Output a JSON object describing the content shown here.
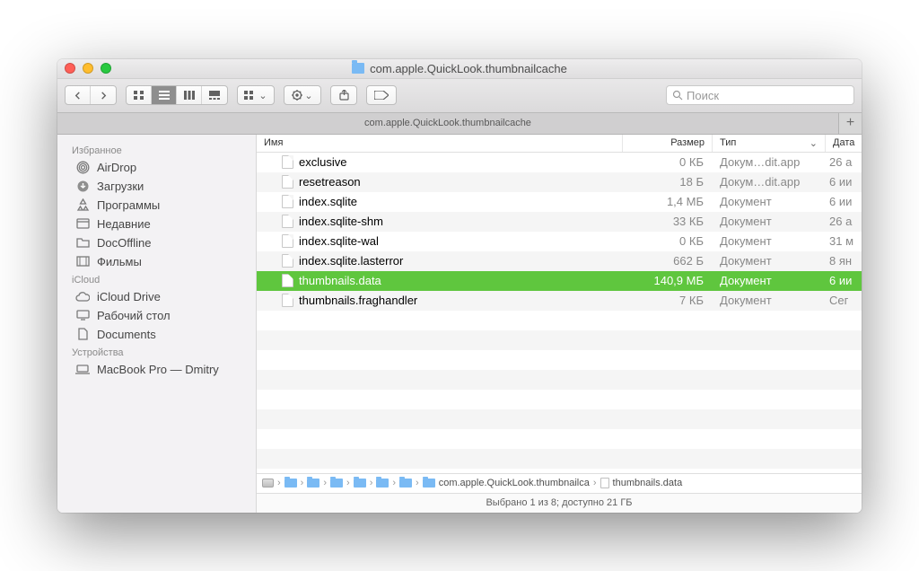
{
  "window": {
    "title": "com.apple.QuickLook.thumbnailcache",
    "tab_title": "com.apple.QuickLook.thumbnailcache"
  },
  "search": {
    "placeholder": "Поиск"
  },
  "sidebar": {
    "sections": [
      {
        "label": "Избранное",
        "items": [
          {
            "icon": "airdrop",
            "label": "AirDrop"
          },
          {
            "icon": "downloads",
            "label": "Загрузки"
          },
          {
            "icon": "apps",
            "label": "Программы"
          },
          {
            "icon": "recents",
            "label": "Недавние"
          },
          {
            "icon": "folder",
            "label": "DocOffline"
          },
          {
            "icon": "movies",
            "label": "Фильмы"
          }
        ]
      },
      {
        "label": "iCloud",
        "items": [
          {
            "icon": "cloud",
            "label": "iCloud Drive"
          },
          {
            "icon": "desktop",
            "label": "Рабочий стол"
          },
          {
            "icon": "documents",
            "label": "Documents"
          }
        ]
      },
      {
        "label": "Устройства",
        "items": [
          {
            "icon": "laptop",
            "label": "MacBook Pro — Dmitry"
          }
        ]
      }
    ]
  },
  "columns": {
    "name": "Имя",
    "size": "Размер",
    "kind": "Тип",
    "date": "Дата"
  },
  "files": [
    {
      "name": "exclusive",
      "size": "0 КБ",
      "kind": "Докум…dit.app",
      "date": "26 а",
      "selected": false
    },
    {
      "name": "resetreason",
      "size": "18 Б",
      "kind": "Докум…dit.app",
      "date": "6 ии",
      "selected": false
    },
    {
      "name": "index.sqlite",
      "size": "1,4 МБ",
      "kind": "Документ",
      "date": "6 ии",
      "selected": false
    },
    {
      "name": "index.sqlite-shm",
      "size": "33 КБ",
      "kind": "Документ",
      "date": "26 а",
      "selected": false
    },
    {
      "name": "index.sqlite-wal",
      "size": "0 КБ",
      "kind": "Документ",
      "date": "31 м",
      "selected": false
    },
    {
      "name": "index.sqlite.lasterror",
      "size": "662 Б",
      "kind": "Документ",
      "date": "8 ян",
      "selected": false
    },
    {
      "name": "thumbnails.data",
      "size": "140,9 МБ",
      "kind": "Документ",
      "date": "6 ии",
      "selected": true
    },
    {
      "name": "thumbnails.fraghandler",
      "size": "7 КБ",
      "kind": "Документ",
      "date": "Сег",
      "selected": false
    }
  ],
  "path": {
    "last_folder": "com.apple.QuickLook.thumbnailca",
    "file": "thumbnails.data"
  },
  "status": "Выбрано 1 из 8; доступно 21 ГБ"
}
